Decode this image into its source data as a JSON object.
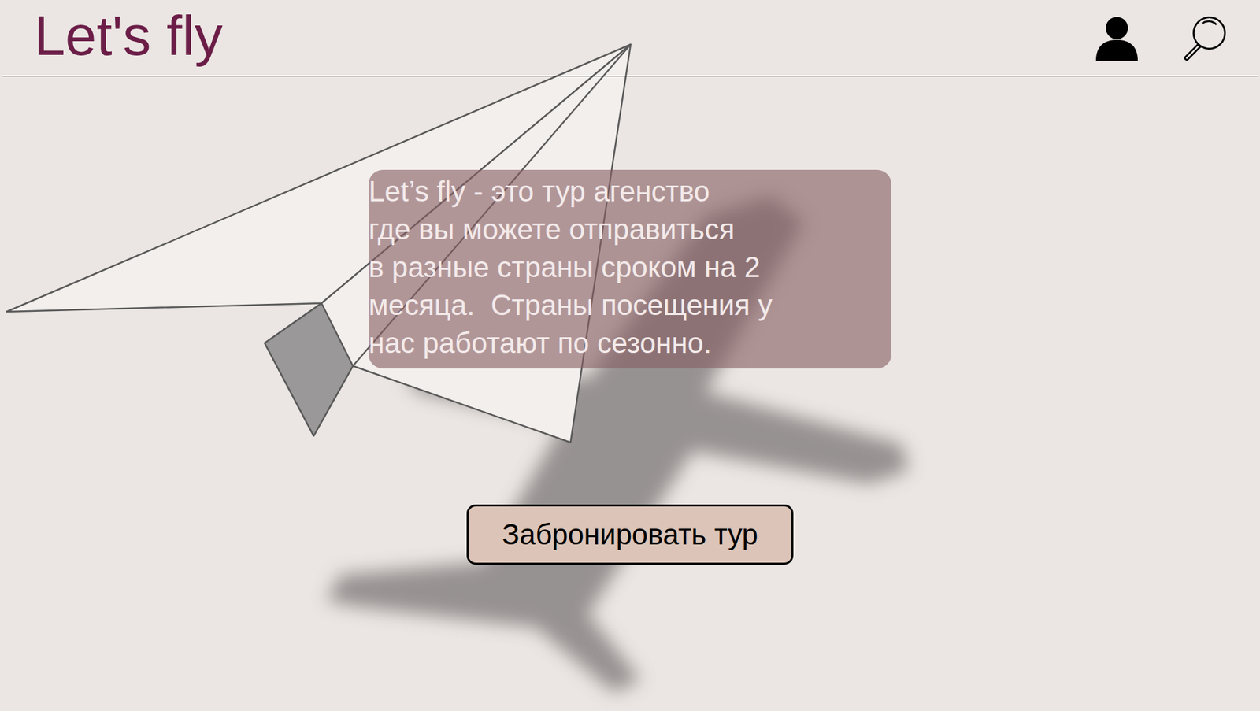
{
  "header": {
    "logo": "Let's fly"
  },
  "intro": {
    "lines": [
      "Let’s fly - это тур агенство",
      "где вы можете отправиться",
      "в разные страны сроком на 2",
      "месяца.  Страны посещения у",
      "нас работают по сезонно."
    ]
  },
  "buttons": [
    "Забронировать тур"
  ]
}
